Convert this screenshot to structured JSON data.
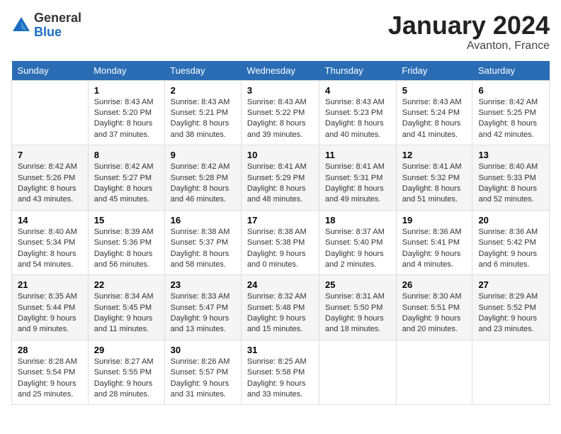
{
  "header": {
    "logo_general": "General",
    "logo_blue": "Blue",
    "month": "January 2024",
    "location": "Avanton, France"
  },
  "weekdays": [
    "Sunday",
    "Monday",
    "Tuesday",
    "Wednesday",
    "Thursday",
    "Friday",
    "Saturday"
  ],
  "weeks": [
    [
      {
        "day": "",
        "info": ""
      },
      {
        "day": "1",
        "info": "Sunrise: 8:43 AM\nSunset: 5:20 PM\nDaylight: 8 hours\nand 37 minutes."
      },
      {
        "day": "2",
        "info": "Sunrise: 8:43 AM\nSunset: 5:21 PM\nDaylight: 8 hours\nand 38 minutes."
      },
      {
        "day": "3",
        "info": "Sunrise: 8:43 AM\nSunset: 5:22 PM\nDaylight: 8 hours\nand 39 minutes."
      },
      {
        "day": "4",
        "info": "Sunrise: 8:43 AM\nSunset: 5:23 PM\nDaylight: 8 hours\nand 40 minutes."
      },
      {
        "day": "5",
        "info": "Sunrise: 8:43 AM\nSunset: 5:24 PM\nDaylight: 8 hours\nand 41 minutes."
      },
      {
        "day": "6",
        "info": "Sunrise: 8:42 AM\nSunset: 5:25 PM\nDaylight: 8 hours\nand 42 minutes."
      }
    ],
    [
      {
        "day": "7",
        "info": "Sunrise: 8:42 AM\nSunset: 5:26 PM\nDaylight: 8 hours\nand 43 minutes."
      },
      {
        "day": "8",
        "info": "Sunrise: 8:42 AM\nSunset: 5:27 PM\nDaylight: 8 hours\nand 45 minutes."
      },
      {
        "day": "9",
        "info": "Sunrise: 8:42 AM\nSunset: 5:28 PM\nDaylight: 8 hours\nand 46 minutes."
      },
      {
        "day": "10",
        "info": "Sunrise: 8:41 AM\nSunset: 5:29 PM\nDaylight: 8 hours\nand 48 minutes."
      },
      {
        "day": "11",
        "info": "Sunrise: 8:41 AM\nSunset: 5:31 PM\nDaylight: 8 hours\nand 49 minutes."
      },
      {
        "day": "12",
        "info": "Sunrise: 8:41 AM\nSunset: 5:32 PM\nDaylight: 8 hours\nand 51 minutes."
      },
      {
        "day": "13",
        "info": "Sunrise: 8:40 AM\nSunset: 5:33 PM\nDaylight: 8 hours\nand 52 minutes."
      }
    ],
    [
      {
        "day": "14",
        "info": "Sunrise: 8:40 AM\nSunset: 5:34 PM\nDaylight: 8 hours\nand 54 minutes."
      },
      {
        "day": "15",
        "info": "Sunrise: 8:39 AM\nSunset: 5:36 PM\nDaylight: 8 hours\nand 56 minutes."
      },
      {
        "day": "16",
        "info": "Sunrise: 8:38 AM\nSunset: 5:37 PM\nDaylight: 8 hours\nand 58 minutes."
      },
      {
        "day": "17",
        "info": "Sunrise: 8:38 AM\nSunset: 5:38 PM\nDaylight: 9 hours\nand 0 minutes."
      },
      {
        "day": "18",
        "info": "Sunrise: 8:37 AM\nSunset: 5:40 PM\nDaylight: 9 hours\nand 2 minutes."
      },
      {
        "day": "19",
        "info": "Sunrise: 8:36 AM\nSunset: 5:41 PM\nDaylight: 9 hours\nand 4 minutes."
      },
      {
        "day": "20",
        "info": "Sunrise: 8:36 AM\nSunset: 5:42 PM\nDaylight: 9 hours\nand 6 minutes."
      }
    ],
    [
      {
        "day": "21",
        "info": "Sunrise: 8:35 AM\nSunset: 5:44 PM\nDaylight: 9 hours\nand 9 minutes."
      },
      {
        "day": "22",
        "info": "Sunrise: 8:34 AM\nSunset: 5:45 PM\nDaylight: 9 hours\nand 11 minutes."
      },
      {
        "day": "23",
        "info": "Sunrise: 8:33 AM\nSunset: 5:47 PM\nDaylight: 9 hours\nand 13 minutes."
      },
      {
        "day": "24",
        "info": "Sunrise: 8:32 AM\nSunset: 5:48 PM\nDaylight: 9 hours\nand 15 minutes."
      },
      {
        "day": "25",
        "info": "Sunrise: 8:31 AM\nSunset: 5:50 PM\nDaylight: 9 hours\nand 18 minutes."
      },
      {
        "day": "26",
        "info": "Sunrise: 8:30 AM\nSunset: 5:51 PM\nDaylight: 9 hours\nand 20 minutes."
      },
      {
        "day": "27",
        "info": "Sunrise: 8:29 AM\nSunset: 5:52 PM\nDaylight: 9 hours\nand 23 minutes."
      }
    ],
    [
      {
        "day": "28",
        "info": "Sunrise: 8:28 AM\nSunset: 5:54 PM\nDaylight: 9 hours\nand 25 minutes."
      },
      {
        "day": "29",
        "info": "Sunrise: 8:27 AM\nSunset: 5:55 PM\nDaylight: 9 hours\nand 28 minutes."
      },
      {
        "day": "30",
        "info": "Sunrise: 8:26 AM\nSunset: 5:57 PM\nDaylight: 9 hours\nand 31 minutes."
      },
      {
        "day": "31",
        "info": "Sunrise: 8:25 AM\nSunset: 5:58 PM\nDaylight: 9 hours\nand 33 minutes."
      },
      {
        "day": "",
        "info": ""
      },
      {
        "day": "",
        "info": ""
      },
      {
        "day": "",
        "info": ""
      }
    ]
  ]
}
